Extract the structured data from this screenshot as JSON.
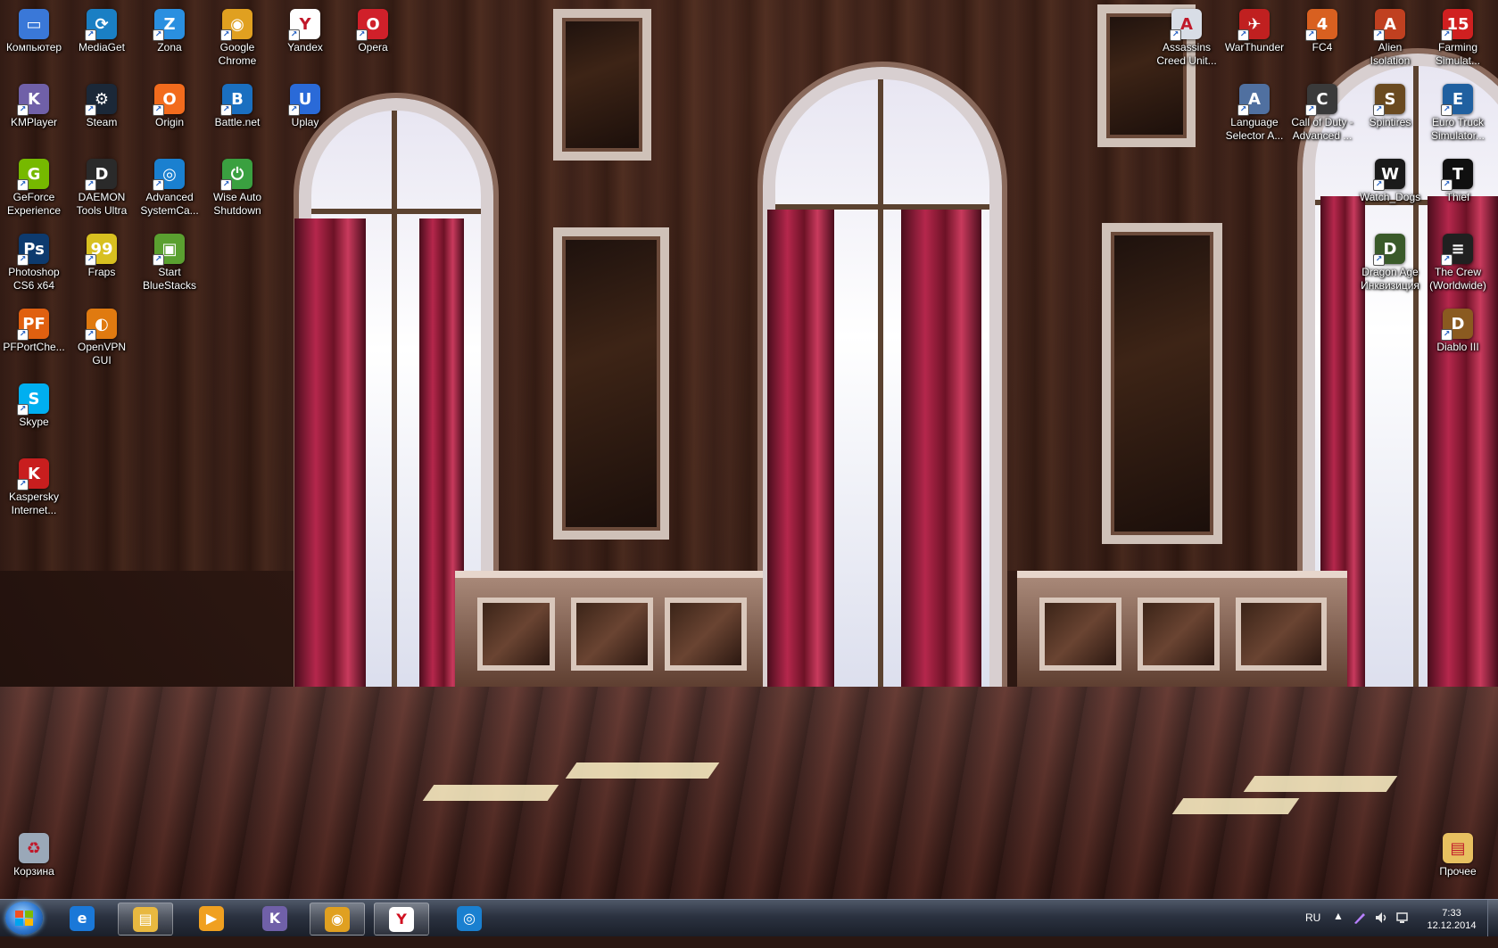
{
  "desktop_icons": [
    {
      "label": "Компьютер",
      "icon": "computer-icon",
      "color": "#3a78d8",
      "glyph": "▭"
    },
    {
      "label": "MediaGet",
      "icon": "mediaget-icon",
      "color": "#1a7fc4",
      "glyph": "⟳"
    },
    {
      "label": "Zona",
      "icon": "zona-icon",
      "color": "#2a8fe0",
      "glyph": "Z"
    },
    {
      "label": "Google\nChrome",
      "icon": "chrome-icon",
      "color": "#e0a020",
      "glyph": "◉"
    },
    {
      "label": "Yandex",
      "icon": "yandex-icon",
      "color": "#ffffff",
      "glyph": "Y"
    },
    {
      "label": "Opera",
      "icon": "opera-icon",
      "color": "#d0202a",
      "glyph": "O"
    },
    {
      "label": "KMPlayer",
      "icon": "kmplayer-icon",
      "color": "#7060a8",
      "glyph": "K"
    },
    {
      "label": "Steam",
      "icon": "steam-icon",
      "color": "#1b2838",
      "glyph": "⚙"
    },
    {
      "label": "Origin",
      "icon": "origin-icon",
      "color": "#f26b1d",
      "glyph": "O"
    },
    {
      "label": "Battle.net",
      "icon": "battlenet-icon",
      "color": "#1a6fc0",
      "glyph": "B"
    },
    {
      "label": "Uplay",
      "icon": "uplay-icon",
      "color": "#2a6ad8",
      "glyph": "U"
    },
    {
      "label": "GeForce\nExperience",
      "icon": "geforce-icon",
      "color": "#76b900",
      "glyph": "G"
    },
    {
      "label": "DAEMON\nTools Ultra",
      "icon": "daemon-tools-icon",
      "color": "#2a2a2a",
      "glyph": "D"
    },
    {
      "label": "Advanced\nSystemCa...",
      "icon": "advanced-systemcare-icon",
      "color": "#1a80d0",
      "glyph": "◎"
    },
    {
      "label": "Wise Auto\nShutdown",
      "icon": "wise-auto-shutdown-icon",
      "color": "#3aa040",
      "glyph": "⏻"
    },
    {
      "label": "Photoshop\nCS6 x64",
      "icon": "photoshop-icon",
      "color": "#0d3a6e",
      "glyph": "Ps"
    },
    {
      "label": "Fraps",
      "icon": "fraps-icon",
      "color": "#d8c020",
      "glyph": "99"
    },
    {
      "label": "Start\nBlueStacks",
      "icon": "bluestacks-icon",
      "color": "#5aa030",
      "glyph": "▣"
    },
    {
      "label": "PFPortChe...",
      "icon": "pfportchecker-icon",
      "color": "#e06010",
      "glyph": "PF"
    },
    {
      "label": "OpenVPN\nGUI",
      "icon": "openvpn-icon",
      "color": "#e07a10",
      "glyph": "◐"
    },
    {
      "label": "Skype",
      "icon": "skype-icon",
      "color": "#00aff0",
      "glyph": "S"
    },
    {
      "label": "Kaspersky\nInternet...",
      "icon": "kaspersky-icon",
      "color": "#c81e1e",
      "glyph": "K"
    },
    {
      "label": "Корзина",
      "icon": "recycle-bin-icon",
      "color": "#9aa8b8",
      "glyph": "♻"
    },
    {
      "label": "Assassins\nCreed Unit...",
      "icon": "assassins-creed-icon",
      "color": "#d8dde6",
      "glyph": "A"
    },
    {
      "label": "WarThunder",
      "icon": "warthunder-icon",
      "color": "#c02020",
      "glyph": "✈"
    },
    {
      "label": "FC4",
      "icon": "fc4-icon",
      "color": "#d86020",
      "glyph": "4"
    },
    {
      "label": "Alien\nIsolation",
      "icon": "alien-isolation-icon",
      "color": "#c04020",
      "glyph": "A"
    },
    {
      "label": "Farming\nSimulat...",
      "icon": "farming-simulator-icon",
      "color": "#d02020",
      "glyph": "15"
    },
    {
      "label": "Language\nSelector A...",
      "icon": "language-selector-icon",
      "color": "#5070a0",
      "glyph": "A"
    },
    {
      "label": "Call of Duty -\nAdvanced ...",
      "icon": "call-of-duty-icon",
      "color": "#3a3a3a",
      "glyph": "C"
    },
    {
      "label": "Spintires",
      "icon": "spintires-icon",
      "color": "#6a4a20",
      "glyph": "S"
    },
    {
      "label": "Euro Truck\nSimulator...",
      "icon": "euro-truck-icon",
      "color": "#2060a0",
      "glyph": "E"
    },
    {
      "label": "Watch_Dogs",
      "icon": "watch-dogs-icon",
      "color": "#1a1a1a",
      "glyph": "W"
    },
    {
      "label": "Thief",
      "icon": "thief-icon",
      "color": "#101010",
      "glyph": "T"
    },
    {
      "label": "Dragon Age\nИнквизиция",
      "icon": "dragon-age-icon",
      "color": "#3a5a2a",
      "glyph": "D"
    },
    {
      "label": "The Crew\n(Worldwide)",
      "icon": "the-crew-icon",
      "color": "#202020",
      "glyph": "≡"
    },
    {
      "label": "Diablo III",
      "icon": "diablo-icon",
      "color": "#8a5a20",
      "glyph": "D"
    },
    {
      "label": "Прочее",
      "icon": "folder-icon",
      "color": "#e8c060",
      "glyph": "▤"
    }
  ],
  "taskbar": {
    "start_button": "start-icon",
    "pinned": [
      {
        "icon": "internet-explorer-icon",
        "color": "#1a78d8",
        "glyph": "e",
        "active": false
      },
      {
        "icon": "explorer-folder-icon",
        "color": "#e8b840",
        "glyph": "▤",
        "active": true
      },
      {
        "icon": "media-player-icon",
        "color": "#f0a020",
        "glyph": "▶",
        "active": false
      },
      {
        "icon": "kmplayer-icon",
        "color": "#7060a8",
        "glyph": "K",
        "active": false
      },
      {
        "icon": "chrome-icon",
        "color": "#e0a020",
        "glyph": "◉",
        "active": true
      },
      {
        "icon": "yandex-icon",
        "color": "#ffffff",
        "glyph": "Y",
        "active": true
      },
      {
        "icon": "advanced-systemcare-icon",
        "color": "#1a80d0",
        "glyph": "◎",
        "active": false
      }
    ],
    "language": "RU",
    "tray_up_arrow": "▲",
    "clock_time": "7:33",
    "clock_date": "12.12.2014"
  }
}
